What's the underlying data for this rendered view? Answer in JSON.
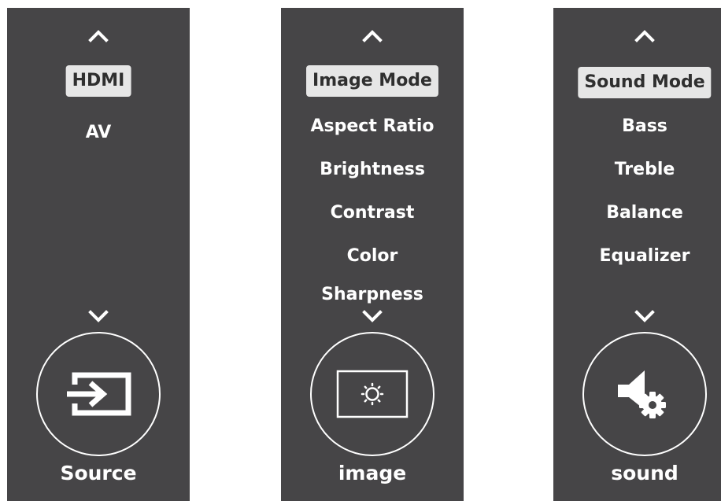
{
  "panels": {
    "source": {
      "label": "Source",
      "icon": "source-input-icon",
      "items": [
        "HDMI",
        "AV"
      ],
      "selected": "HDMI"
    },
    "image": {
      "label": "image",
      "icon": "picture-settings-icon",
      "items": [
        "Image Mode",
        "Aspect Ratio",
        "Brightness",
        "Contrast",
        "Color",
        "Sharpness"
      ],
      "selected": "Image Mode"
    },
    "sound": {
      "label": "sound",
      "icon": "sound-settings-icon",
      "items": [
        "Sound Mode",
        "Bass",
        "Treble",
        "Balance",
        "Equalizer"
      ],
      "selected": "Sound Mode"
    }
  },
  "colors": {
    "panel_bg": "#464547",
    "selected_bg": "#e6e6e6",
    "selected_text": "#2f2f2f",
    "text": "#ffffff"
  }
}
